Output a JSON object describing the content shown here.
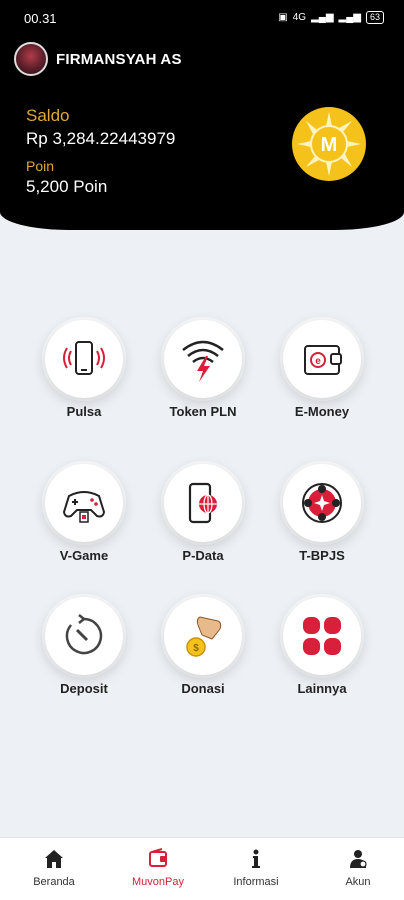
{
  "status_bar": {
    "time": "00.31",
    "network": "4G",
    "battery": "63"
  },
  "header": {
    "username": "FIRMANSYAH AS",
    "saldo_label": "Saldo",
    "saldo_value": "Rp 3,284.22443979",
    "poin_label": "Poin",
    "poin_value": "5,200 Poin",
    "logo_letter": "M"
  },
  "menu": [
    {
      "label": "Pulsa",
      "icon": "phone-signal-icon"
    },
    {
      "label": "Token PLN",
      "icon": "wifi-lightning-icon"
    },
    {
      "label": "E-Money",
      "icon": "wallet-icon"
    },
    {
      "label": "V-Game",
      "icon": "gamepad-icon"
    },
    {
      "label": "P-Data",
      "icon": "phone-globe-icon"
    },
    {
      "label": "T-BPJS",
      "icon": "bpjs-icon"
    },
    {
      "label": "Deposit",
      "icon": "deposit-clock-icon"
    },
    {
      "label": "Donasi",
      "icon": "hand-coin-icon"
    },
    {
      "label": "Lainnya",
      "icon": "more-grid-icon"
    }
  ],
  "bottom_nav": [
    {
      "label": "Beranda",
      "icon": "home-icon",
      "active": false
    },
    {
      "label": "MuvonPay",
      "icon": "wallet-icon",
      "active": true
    },
    {
      "label": "Informasi",
      "icon": "info-icon",
      "active": false
    },
    {
      "label": "Akun",
      "icon": "user-icon",
      "active": false
    }
  ],
  "colors": {
    "accent": "#d8203a",
    "gold": "#e0a935",
    "background": "#edf0f5"
  }
}
